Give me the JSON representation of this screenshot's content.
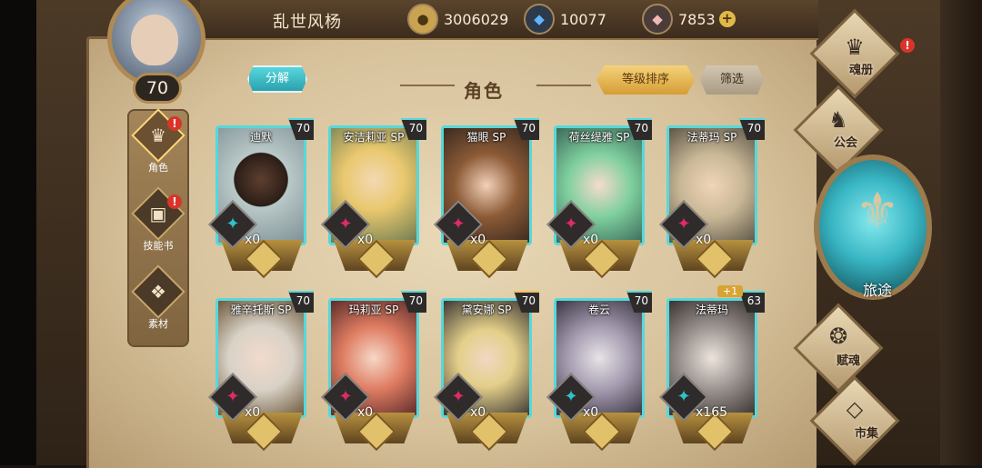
{
  "header": {
    "player_name": "乱世风杨",
    "level": "70",
    "gold": "3006029",
    "crystal": "10077",
    "stone": "7853",
    "gold_icon": "coin-icon",
    "crystal_icon": "blue-crystal-icon",
    "stone_icon": "pink-stone-icon"
  },
  "sidebar": {
    "items": [
      {
        "label": "角色",
        "icon": "hero-crest-icon",
        "alert": "!"
      },
      {
        "label": "技能书",
        "icon": "skill-book-icon",
        "alert": "!"
      },
      {
        "label": "素材",
        "icon": "material-icon"
      }
    ]
  },
  "toolbar": {
    "decompose": "分解",
    "title": "角色",
    "sort": "等级排序",
    "filter": "筛选"
  },
  "cards": [
    {
      "name": "迪默",
      "level": "70",
      "count": "x0"
    },
    {
      "name": "安洁莉亚 SP",
      "level": "70",
      "count": "x0"
    },
    {
      "name": "猫眼 SP",
      "level": "70",
      "count": "x0"
    },
    {
      "name": "荷丝缇雅 SP",
      "level": "70",
      "count": "x0"
    },
    {
      "name": "法蒂玛 SP",
      "level": "70",
      "count": "x0"
    },
    {
      "name": "雅辛托斯 SP",
      "level": "70",
      "count": "x0"
    },
    {
      "name": "玛莉亚 SP",
      "level": "70",
      "count": "x0"
    },
    {
      "name": "黛安娜 SP",
      "level": "70",
      "count": "x0"
    },
    {
      "name": "卷云",
      "level": "70",
      "count": "x0"
    },
    {
      "name": "法蒂玛",
      "level": "63",
      "count": "x165",
      "bonus": "+1"
    }
  ],
  "nav": {
    "soul_book": "魂册",
    "guild": "公会",
    "journey": "旅途",
    "soul_grant": "赋魂",
    "market": "市集"
  },
  "colors": {
    "card_border": "#56d8dc",
    "gold_button": "#e6b04a",
    "teal_button": "#3fbcc6",
    "alert": "#d9342a"
  }
}
